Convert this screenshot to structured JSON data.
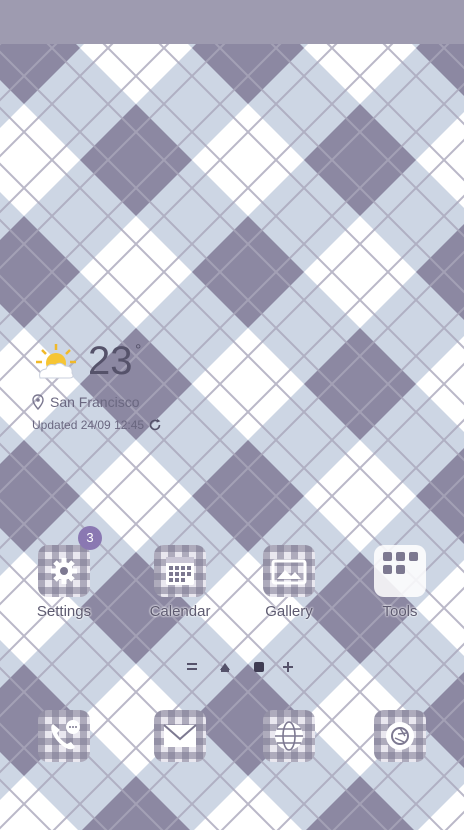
{
  "weather": {
    "temperature": "23",
    "unit": "°",
    "location": "San Francisco",
    "updated": "Updated 24/09 12:45"
  },
  "apps": [
    {
      "label": "Settings",
      "badge": "3"
    },
    {
      "label": "Calendar"
    },
    {
      "label": "Gallery"
    },
    {
      "label": "Tools"
    }
  ],
  "colors": {
    "wallpaper_base": "#cdd6e4",
    "wallpaper_dark": "#8c88a2",
    "status_bar": "#9e9bb0",
    "badge": "#8a78b2"
  }
}
